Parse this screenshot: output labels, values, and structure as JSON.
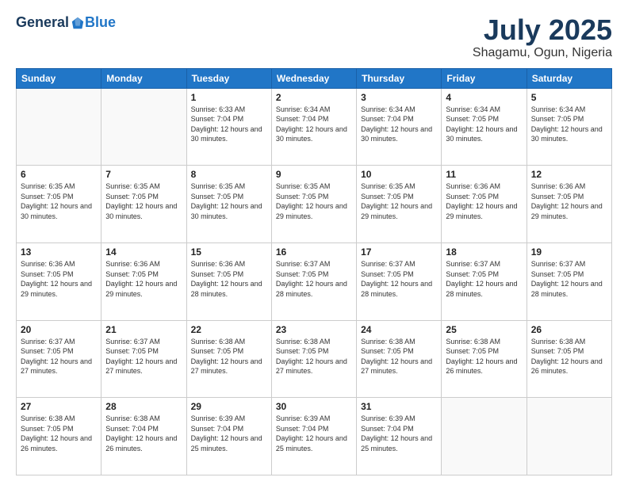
{
  "header": {
    "logo_general": "General",
    "logo_blue": "Blue",
    "month_title": "July 2025",
    "location": "Shagamu, Ogun, Nigeria"
  },
  "days_of_week": [
    "Sunday",
    "Monday",
    "Tuesday",
    "Wednesday",
    "Thursday",
    "Friday",
    "Saturday"
  ],
  "weeks": [
    [
      {
        "day": "",
        "info": ""
      },
      {
        "day": "",
        "info": ""
      },
      {
        "day": "1",
        "info": "Sunrise: 6:33 AM\nSunset: 7:04 PM\nDaylight: 12 hours and 30 minutes."
      },
      {
        "day": "2",
        "info": "Sunrise: 6:34 AM\nSunset: 7:04 PM\nDaylight: 12 hours and 30 minutes."
      },
      {
        "day": "3",
        "info": "Sunrise: 6:34 AM\nSunset: 7:04 PM\nDaylight: 12 hours and 30 minutes."
      },
      {
        "day": "4",
        "info": "Sunrise: 6:34 AM\nSunset: 7:05 PM\nDaylight: 12 hours and 30 minutes."
      },
      {
        "day": "5",
        "info": "Sunrise: 6:34 AM\nSunset: 7:05 PM\nDaylight: 12 hours and 30 minutes."
      }
    ],
    [
      {
        "day": "6",
        "info": "Sunrise: 6:35 AM\nSunset: 7:05 PM\nDaylight: 12 hours and 30 minutes."
      },
      {
        "day": "7",
        "info": "Sunrise: 6:35 AM\nSunset: 7:05 PM\nDaylight: 12 hours and 30 minutes."
      },
      {
        "day": "8",
        "info": "Sunrise: 6:35 AM\nSunset: 7:05 PM\nDaylight: 12 hours and 30 minutes."
      },
      {
        "day": "9",
        "info": "Sunrise: 6:35 AM\nSunset: 7:05 PM\nDaylight: 12 hours and 29 minutes."
      },
      {
        "day": "10",
        "info": "Sunrise: 6:35 AM\nSunset: 7:05 PM\nDaylight: 12 hours and 29 minutes."
      },
      {
        "day": "11",
        "info": "Sunrise: 6:36 AM\nSunset: 7:05 PM\nDaylight: 12 hours and 29 minutes."
      },
      {
        "day": "12",
        "info": "Sunrise: 6:36 AM\nSunset: 7:05 PM\nDaylight: 12 hours and 29 minutes."
      }
    ],
    [
      {
        "day": "13",
        "info": "Sunrise: 6:36 AM\nSunset: 7:05 PM\nDaylight: 12 hours and 29 minutes."
      },
      {
        "day": "14",
        "info": "Sunrise: 6:36 AM\nSunset: 7:05 PM\nDaylight: 12 hours and 29 minutes."
      },
      {
        "day": "15",
        "info": "Sunrise: 6:36 AM\nSunset: 7:05 PM\nDaylight: 12 hours and 28 minutes."
      },
      {
        "day": "16",
        "info": "Sunrise: 6:37 AM\nSunset: 7:05 PM\nDaylight: 12 hours and 28 minutes."
      },
      {
        "day": "17",
        "info": "Sunrise: 6:37 AM\nSunset: 7:05 PM\nDaylight: 12 hours and 28 minutes."
      },
      {
        "day": "18",
        "info": "Sunrise: 6:37 AM\nSunset: 7:05 PM\nDaylight: 12 hours and 28 minutes."
      },
      {
        "day": "19",
        "info": "Sunrise: 6:37 AM\nSunset: 7:05 PM\nDaylight: 12 hours and 28 minutes."
      }
    ],
    [
      {
        "day": "20",
        "info": "Sunrise: 6:37 AM\nSunset: 7:05 PM\nDaylight: 12 hours and 27 minutes."
      },
      {
        "day": "21",
        "info": "Sunrise: 6:37 AM\nSunset: 7:05 PM\nDaylight: 12 hours and 27 minutes."
      },
      {
        "day": "22",
        "info": "Sunrise: 6:38 AM\nSunset: 7:05 PM\nDaylight: 12 hours and 27 minutes."
      },
      {
        "day": "23",
        "info": "Sunrise: 6:38 AM\nSunset: 7:05 PM\nDaylight: 12 hours and 27 minutes."
      },
      {
        "day": "24",
        "info": "Sunrise: 6:38 AM\nSunset: 7:05 PM\nDaylight: 12 hours and 27 minutes."
      },
      {
        "day": "25",
        "info": "Sunrise: 6:38 AM\nSunset: 7:05 PM\nDaylight: 12 hours and 26 minutes."
      },
      {
        "day": "26",
        "info": "Sunrise: 6:38 AM\nSunset: 7:05 PM\nDaylight: 12 hours and 26 minutes."
      }
    ],
    [
      {
        "day": "27",
        "info": "Sunrise: 6:38 AM\nSunset: 7:05 PM\nDaylight: 12 hours and 26 minutes."
      },
      {
        "day": "28",
        "info": "Sunrise: 6:38 AM\nSunset: 7:04 PM\nDaylight: 12 hours and 26 minutes."
      },
      {
        "day": "29",
        "info": "Sunrise: 6:39 AM\nSunset: 7:04 PM\nDaylight: 12 hours and 25 minutes."
      },
      {
        "day": "30",
        "info": "Sunrise: 6:39 AM\nSunset: 7:04 PM\nDaylight: 12 hours and 25 minutes."
      },
      {
        "day": "31",
        "info": "Sunrise: 6:39 AM\nSunset: 7:04 PM\nDaylight: 12 hours and 25 minutes."
      },
      {
        "day": "",
        "info": ""
      },
      {
        "day": "",
        "info": ""
      }
    ]
  ]
}
